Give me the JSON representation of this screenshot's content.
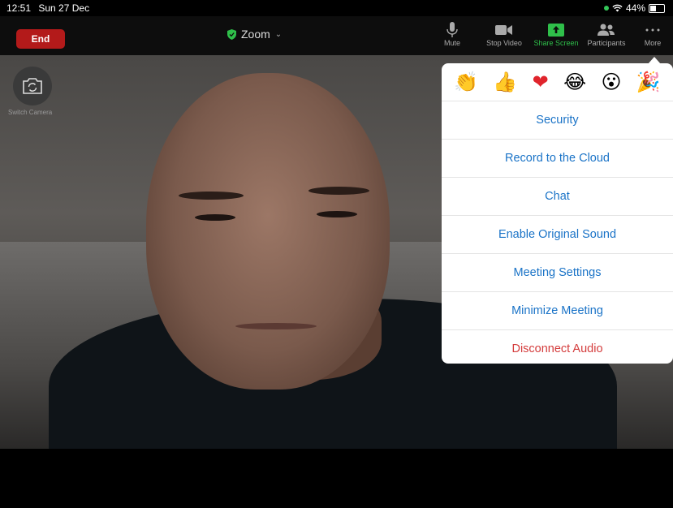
{
  "status_bar": {
    "time": "12:51",
    "date": "Sun 27 Dec",
    "battery": "44%"
  },
  "toolbar": {
    "end_label": "End",
    "meeting_title": "Zoom",
    "tools": [
      {
        "label": "Mute",
        "icon": "microphone-icon"
      },
      {
        "label": "Stop Video",
        "icon": "video-camera-icon"
      },
      {
        "label": "Share Screen",
        "icon": "share-screen-icon"
      },
      {
        "label": "Participants",
        "icon": "participants-icon"
      },
      {
        "label": "More",
        "icon": "more-dots-icon"
      }
    ],
    "accent_color": "#2fbf4a",
    "end_color": "#b31a1a"
  },
  "video": {
    "switch_camera_label": "Switch Camera"
  },
  "more_menu": {
    "reactions": [
      "👏",
      "👍",
      "❤",
      "😂",
      "😮",
      "🎉"
    ],
    "items": [
      "Security",
      "Record to the Cloud",
      "Chat",
      "Enable Original Sound",
      "Meeting Settings",
      "Minimize Meeting",
      "Disconnect Audio"
    ],
    "item_color": "#1a73c7",
    "danger_color": "#d43c3c"
  }
}
